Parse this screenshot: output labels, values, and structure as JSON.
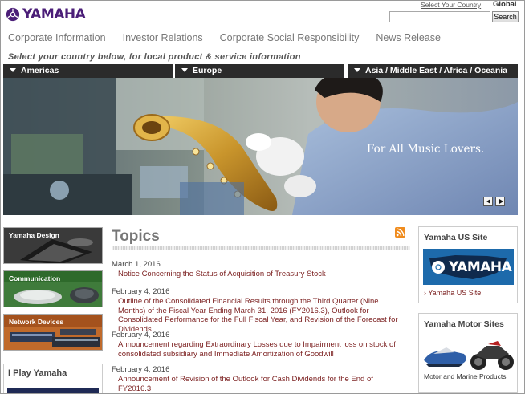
{
  "header": {
    "logo_text": "YAMAHA",
    "country_link": "Select Your Country",
    "global_label": "Global",
    "search_value": "",
    "search_button": "Search"
  },
  "nav": {
    "items": [
      {
        "label": "Corporate Information"
      },
      {
        "label": "Investor Relations"
      },
      {
        "label": "Corporate Social Responsibility"
      },
      {
        "label": "News Release"
      }
    ]
  },
  "regions": {
    "caption": "Select your country below, for local product & service information",
    "items": [
      {
        "label": "Americas"
      },
      {
        "label": "Europe"
      },
      {
        "label": "Asia / Middle East / Africa / Oceania"
      }
    ]
  },
  "hero": {
    "tagline": "For All Music Lovers."
  },
  "left_banners": {
    "items": [
      {
        "label": "Yamaha Design"
      },
      {
        "label": "Communication"
      },
      {
        "label": "Network Devices"
      }
    ],
    "play_title": "I Play Yamaha"
  },
  "topics": {
    "title": "Topics",
    "items": [
      {
        "date": "March 1, 2016",
        "title": "Notice Concerning the Status of Acquisition of Treasury Stock"
      },
      {
        "date": "February 4, 2016",
        "title": "Outline of the Consolidated Financial Results through the Third Quarter (Nine Months) of the Fiscal Year Ending March 31, 2016 (FY2016.3), Outlook for Consolidated Performance for the Full Fiscal Year, and Revision of the Forecast for Dividends"
      },
      {
        "date": "February 4, 2016",
        "title": "Announcement regarding Extraordinary Losses due to Impairment loss on stock of consolidated subsidiary and Immediate Amortization of Goodwill"
      },
      {
        "date": "February 4, 2016",
        "title": "Announcement of Revision of the Outlook for Cash Dividends for the End of FY2016.3"
      }
    ]
  },
  "sidebar": {
    "us_title": "Yamaha US Site",
    "us_banner_text": "YAMAHA",
    "us_link": "Yamaha US Site",
    "motor_title": "Yamaha Motor Sites",
    "motor_caption": "Motor and Marine Products"
  },
  "colors": {
    "brand_purple": "#4b1e78",
    "link_maroon": "#7b1f1f",
    "region_bar": "#2b2b2b",
    "rss_orange": "#f08c1e"
  },
  "icons": [
    "tuning-fork-logo-icon",
    "dropdown-triangle-icon",
    "rss-icon",
    "prev-arrow-icon",
    "next-arrow-icon"
  ]
}
